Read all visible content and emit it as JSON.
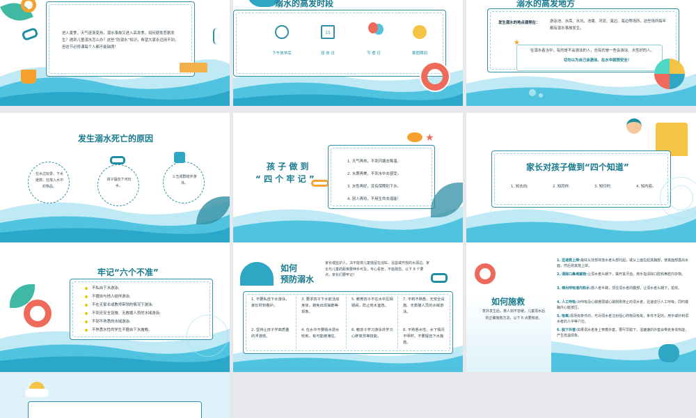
{
  "slides": {
    "s1": {
      "intro": "进入夏季，天气逐渐变热，溺水事故又进入高发季。如何避免悲剧发生？遇到儿童溺水怎么办？这些“防溺水”知识，希望大家永远用不到，但这节必修课每个人都不能缺席！"
    },
    "s2": {
      "title": "溺水的高发时段",
      "items": [
        "下午放学后",
        "双 休 日",
        "节 假 日",
        "寒假期间"
      ],
      "date_num": "15"
    },
    "s3": {
      "title": "溺水的高发地方",
      "label": "发生溺水的地点通常在：",
      "places": "游泳池、水库、水坑、池塘、河流、溪边、海边等场所，这些场所每年都有溺水事故发生。",
      "note": "在溺水者当中，有的是不会游泳的人，也有的是一些会游泳、水性好的人。",
      "note_bold": "切勿以为自己会游泳、在水中就很安全！"
    },
    "s4": {
      "title": "发生溺水死亡的原因",
      "reasons": [
        "在水边玩耍，下水援救，捡落入水中的物品。",
        "孩子擅自下河玩水。",
        "三五成群结伴游泳。"
      ]
    },
    "s5": {
      "title_line1": "孩 子 做 到",
      "title_line2": "“ 四 个 牢 记 ”",
      "items": [
        "1. 天气再热，不到河塘去降温。",
        "2. 水质再美，不到水中去感受。",
        "3. 水性再好，没有保障别下水。",
        "4. 别人再劝，不用生命去逞能！"
      ]
    },
    "s6": {
      "title": "家长对孩子做到“四个知道”",
      "items": [
        "1. 知去向;",
        "2. 知同伴;",
        "3. 知归时;",
        "4. 知内容。"
      ]
    },
    "s7": {
      "title": "牢记“六个不准”",
      "items": [
        "不私自下水游泳;",
        "不擅自与他人结伴游泳;",
        "不在无家长或教师带领的情况下游泳;",
        "不到无安全设施、无救援人员的水域游泳;",
        "不到不熟悉的水域游泳;",
        "不熟悉水性的学生不擅自下水施救。"
      ]
    },
    "s8": {
      "title_line1": "如何",
      "title_line2": "预防溺水",
      "intro": "家长或监护人，决不能将儿童独留在浴缸、浴盆或开放的水源边。家长与儿童的距离要伸手可及，专心看管，不能疏忽。以下 8 个要点，家长们要牢记！",
      "cols": [
        [
          "1. 不要私自下水游泳，家长时刻看护。",
          "2. 坚持让孩子学高质量的浮游技。"
        ],
        [
          "3. 要求孩子下水前活动身体，避免出现抽筋等现象。",
          "4. 在水中不要嬉水把水呛到，有可能被淹住。"
        ],
        [
          "5. 教育孩子不在水中互相嬉闹，防止呛水窒息。",
          "6. 教孩子学习游泳并学习心肺复苏等技能。"
        ],
        [
          "7. 不到不熟悉、无安全设施、无救援人员的水域游泳。",
          "8. 不熟悉水性、水下情况不明时，不要擅自下水施救。"
        ]
      ]
    },
    "s9": {
      "title": "如何施救",
      "sub": "意外发生后，救人刻不容缓，儿童溺水后的正确施救方法，以下 6 点要知道。",
      "steps": [
        {
          "h": "1. 迅速救上岸:",
          "t": "最好从背部将落水者头部托起，或从上面拉起其胸部，使其面部露出水面，然后将其拖上岸。"
        },
        {
          "h": "2. 清除口鼻堵塞物:",
          "t": "让溺水者头朝下，撬开其牙齿，用手指清除口腔和鼻腔内杂物。"
        },
        {
          "h": "3. 倒出呼吸道内积水:",
          "t": "救人者半蹲，顶住溺水者的腹部，让溺水者头朝下，拍背。"
        },
        {
          "h": "4. 人工呼吸:",
          "t": "对呼吸及心跳微弱或心跳刚刚停止的溺水者，迅速进行人工呼吸，同时做胸外心脏按压。"
        },
        {
          "h": "5. 吸氧:",
          "t": "现场有条件的，可对溺水者注射强心药物及吸氧，条件不足的，用手或针刺溺水者的人中等穴位。"
        },
        {
          "h": "6. 脱下外套:",
          "t": "如果溺水者身上穿着外套，要尽早脱下，湿漉漉的外套会带走身体热能，产生低温现象。"
        }
      ]
    }
  },
  "colors": {
    "teal": "#16798d",
    "water": "#4fc3e0",
    "light_water": "#bfeaf5",
    "accent": "#f0c419"
  }
}
